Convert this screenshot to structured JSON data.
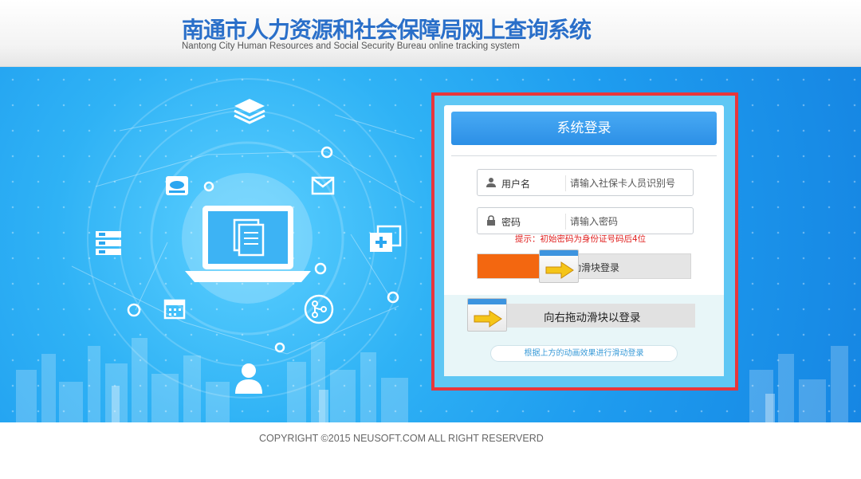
{
  "header": {
    "title": "南通市人力资源和社会保障局网上查询系统",
    "subtitle": "Nantong City Human Resources and Social Security Bureau online tracking system"
  },
  "login": {
    "title": "系统登录",
    "username_label": "用户名",
    "username_placeholder": "请输入社保卡人员识别号",
    "password_label": "密码",
    "password_placeholder": "请输入密码",
    "hint": "提示：初始密码为身份证号码后4位",
    "slider_animated_text": "动滑块登录",
    "slider_animated_progress": 0.29,
    "slider_text": "向右拖动滑块以登录",
    "animation_note": "根据上方的动画效果进行滑动登录"
  },
  "footer": {
    "copyright": "COPYRIGHT ©2015 NEUSOFT.COM ALL RIGHT RESERVERD"
  },
  "colors": {
    "title_blue": "#2a6fc9",
    "hero_blue": "#1e9cef",
    "header_button": "#2c8fe6",
    "highlight_red": "#e8363b",
    "slider_orange": "#f36710",
    "arrow_yellow": "#f5c518",
    "hint_red": "#e0201f"
  },
  "icons": [
    "user-icon",
    "lock-icon",
    "arrow-right-icon",
    "layers-icon",
    "cloud-drive-icon",
    "mail-icon",
    "server-icon",
    "add-window-icon",
    "calendar-icon",
    "share-icon",
    "person-icon",
    "laptop-documents-icon"
  ]
}
